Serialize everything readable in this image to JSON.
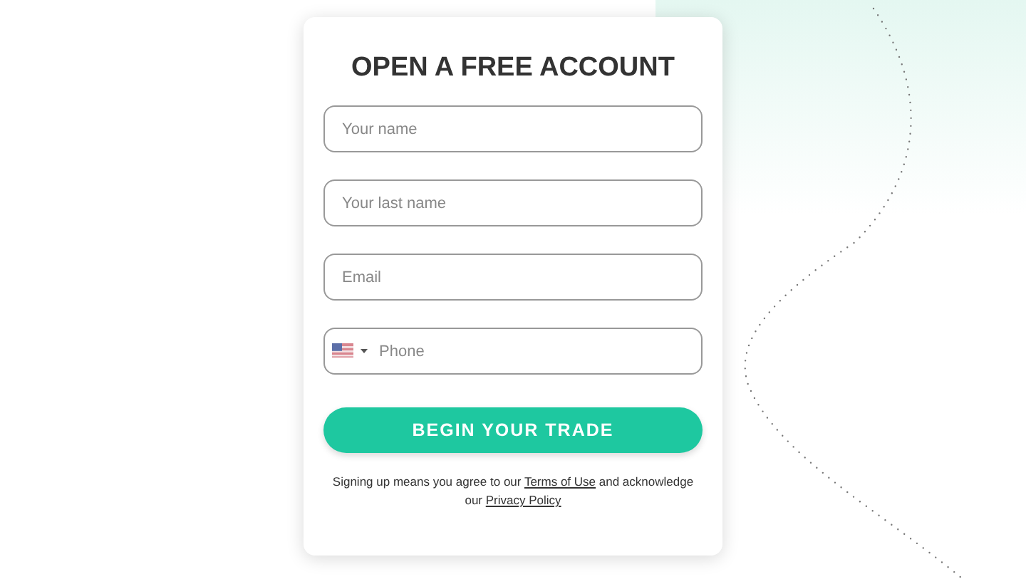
{
  "form": {
    "title": "OPEN A FREE ACCOUNT",
    "fields": [
      {
        "kind": "text",
        "placeholder": "Your name"
      },
      {
        "kind": "text",
        "placeholder": "Your last name"
      },
      {
        "kind": "text",
        "placeholder": "Email"
      },
      {
        "kind": "phone",
        "placeholder": "Phone"
      }
    ],
    "submit": "BEGIN YOUR TRADE",
    "legal": {
      "before": "Signing up means you agree to our",
      "terms": "Terms of Use",
      "middle": "and acknowledge our",
      "privacy": "Privacy Policy"
    }
  }
}
